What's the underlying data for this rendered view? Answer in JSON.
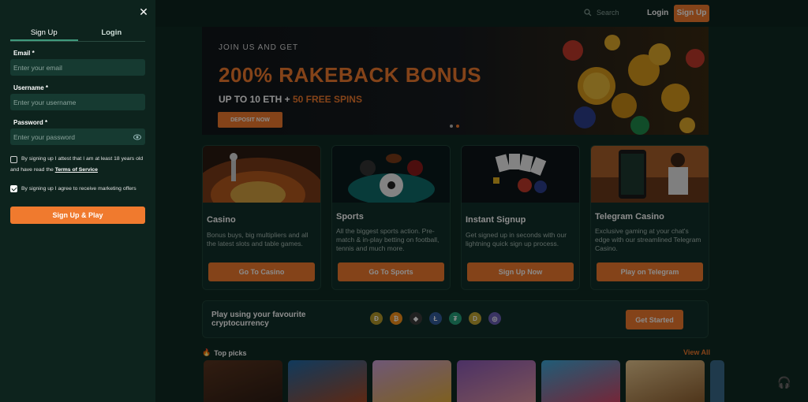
{
  "sidebar": {
    "tabs": [
      "Sign Up",
      "Login"
    ],
    "email_label": "Email *",
    "email_placeholder": "Enter your email",
    "username_label": "Username *",
    "username_placeholder": "Enter your username",
    "password_label": "Password *",
    "password_placeholder": "Enter your password",
    "age_check_text": "By signing up I attest that I am at least 18 years old",
    "age_check_text2": "and have read the",
    "tos_link": "Terms of Service",
    "age_checked": false,
    "marketing_check_text": "By signing up I agree to receive marketing offers",
    "marketing_checked": true,
    "submit_label": "Sign Up & Play"
  },
  "topbar": {
    "search_placeholder": "Search",
    "login_label": "Login",
    "signup_label": "Sign Up"
  },
  "hero": {
    "subtitle": "JOIN US AND GET",
    "title": "200% RAKEBACK BONUS",
    "line_part1": "UP TO 10 ETH + ",
    "line_highlight": "50 FREE SPINS",
    "button_label": "DEPOSIT NOW",
    "active_slide": 2,
    "slide_count": 2
  },
  "cards": [
    {
      "title": "Casino",
      "desc": "Bonus buys, big multipliers and all the latest slots and table games.",
      "button": "Go To Casino"
    },
    {
      "title": "Sports",
      "desc": "All the biggest sports action. Pre-match & in-play betting on football, tennis and much more.",
      "button": "Go To Sports"
    },
    {
      "title": "Instant Signup",
      "desc": "Get signed up in seconds with our lightning quick sign up process.",
      "button": "Sign Up Now"
    },
    {
      "title": "Telegram Casino",
      "desc": "Exclusive gaming at your chat's edge with our streamlined Telegram Casino.",
      "button": "Play on Telegram"
    }
  ],
  "crypto": {
    "text": "Play using your favourite cryptocurrency",
    "icons": [
      "doge-icon",
      "bitcoin-icon",
      "ethereum-icon",
      "litecoin-icon",
      "tether-icon",
      "dogecoin-icon",
      "solana-icon"
    ],
    "button": "Get Started"
  },
  "picks": {
    "title": "Top picks",
    "view_all": "View All"
  },
  "colors": {
    "accent": "#f07a2e",
    "sidebar_bg": "#0d231d",
    "page_bg": "#0f2a23"
  }
}
